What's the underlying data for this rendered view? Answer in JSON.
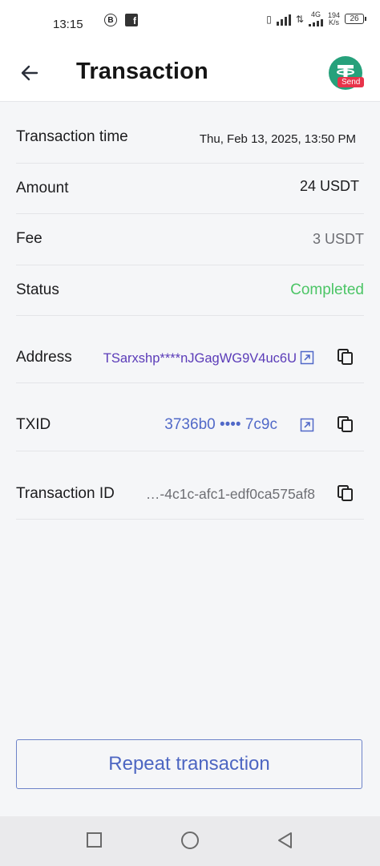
{
  "status_bar": {
    "time": "13:15",
    "network": "4G",
    "speed": "194",
    "speed_unit": "K/s",
    "battery": "26"
  },
  "header": {
    "title": "Transaction",
    "badge": "Send"
  },
  "details": {
    "time_label": "Transaction time",
    "time_value": "Thu, Feb 13, 2025, 13:50 PM",
    "amount_label": "Amount",
    "amount_value": "24 USDT",
    "fee_label": "Fee",
    "fee_value": "3 USDT",
    "status_label": "Status",
    "status_value": "Completed",
    "address_label": "Address",
    "address_value": "TSarxshp****nJGagWG9V4uc6U",
    "txid_label": "TXID",
    "txid_value": "3736b0 •••• 7c9c",
    "txn_id_label": "Transaction ID",
    "txn_id_value": "…-4c1c-afc1-edf0ca575af8"
  },
  "actions": {
    "repeat_label": "Repeat transaction"
  },
  "colors": {
    "completed": "#4cc566",
    "address_link": "#5a3bb8",
    "txid_link": "#5169c8",
    "tether_green": "#26a17b",
    "send_badge": "#e8334a"
  },
  "icons": [
    "back-arrow-icon",
    "tether-logo-icon",
    "external-link-icon",
    "copy-icon",
    "square-nav-icon",
    "circle-nav-icon",
    "triangle-back-nav-icon"
  ]
}
